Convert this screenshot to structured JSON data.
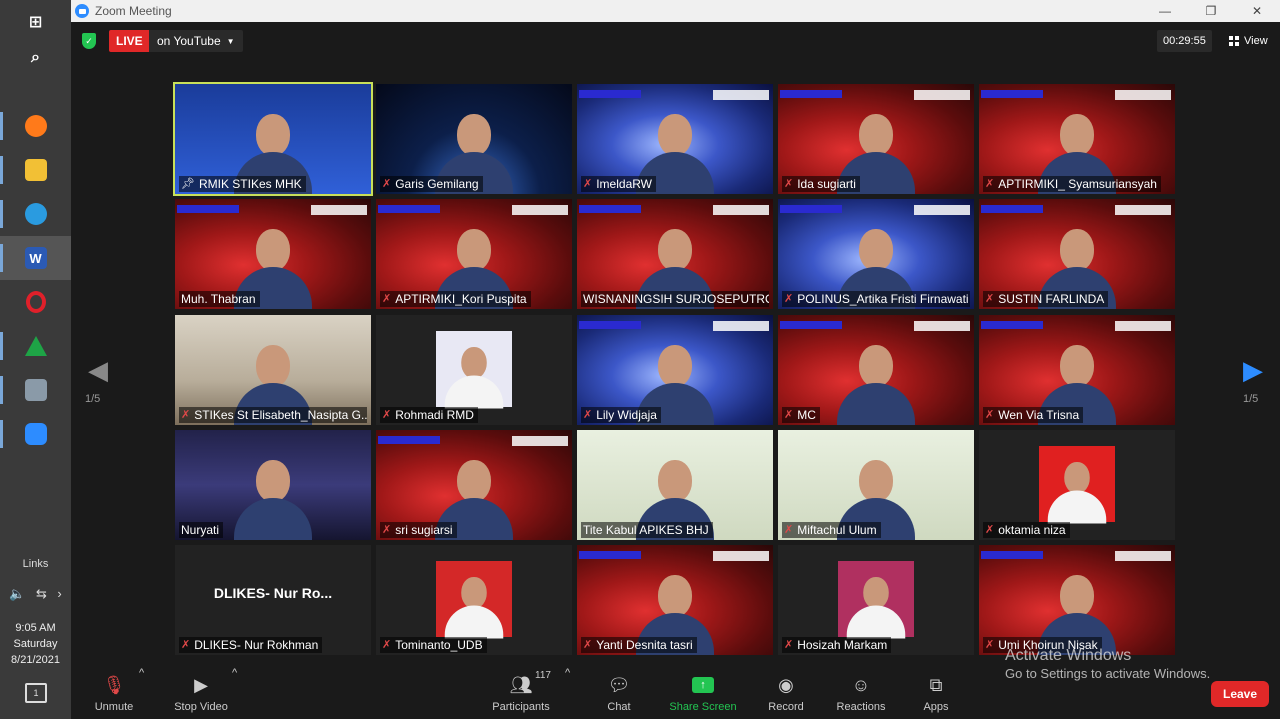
{
  "window": {
    "title": "Zoom Meeting",
    "minimize": "—",
    "maximize": "❐",
    "close": "✕"
  },
  "live": {
    "badge": "LIVE",
    "platform": "on YouTube"
  },
  "timer": "00:29:55",
  "view_label": "View",
  "pagination": {
    "prev_page": "1/5",
    "next_page": "1/5"
  },
  "participants": [
    {
      "name": "RMIK STIKes MHK",
      "pinned": true
    },
    {
      "name": "Garis Gemilang",
      "muted": true
    },
    {
      "name": "ImeldaRW",
      "muted": true
    },
    {
      "name": "Ida sugiarti",
      "muted": true
    },
    {
      "name": "APTIRMIKI_ Syamsuriansyah",
      "muted": true
    },
    {
      "name": "Muh. Thabran",
      "muted": false
    },
    {
      "name": "APTIRMIKI_Kori Puspita",
      "muted": true
    },
    {
      "name": "WISNANINGSIH SURJOSEPUTRO",
      "muted": false
    },
    {
      "name": "POLINUS_Artika Fristi Firnawati",
      "muted": true
    },
    {
      "name": "SUSTIN FARLINDA",
      "muted": true
    },
    {
      "name": "STIKes St Elisabeth_Nasipta G...",
      "muted": true
    },
    {
      "name": "Rohmadi RMD",
      "muted": true
    },
    {
      "name": "Lily Widjaja",
      "muted": true
    },
    {
      "name": "MC",
      "muted": true
    },
    {
      "name": "Wen Via Trisna",
      "muted": true
    },
    {
      "name": "Nuryati",
      "muted": false
    },
    {
      "name": "sri sugiarsi",
      "muted": true
    },
    {
      "name": "Tite Kabul APIKES BHJ",
      "muted": false
    },
    {
      "name": "Miftachul Ulum",
      "muted": true
    },
    {
      "name": "oktamia niza",
      "muted": true
    },
    {
      "name": "DLIKES- Nur Rokhman",
      "muted": true,
      "center_label": "DLIKES- Nur Ro..."
    },
    {
      "name": "Tominanto_UDB",
      "muted": true
    },
    {
      "name": "Yanti Desnita tasri",
      "muted": true
    },
    {
      "name": "Hosizah Markam",
      "muted": true
    },
    {
      "name": "Umi Khoirun Nisak",
      "muted": true
    }
  ],
  "toolbar": {
    "unmute": "Unmute",
    "stop_video": "Stop Video",
    "participants": "Participants",
    "participants_count": "117",
    "chat": "Chat",
    "share_screen": "Share Screen",
    "record": "Record",
    "reactions": "Reactions",
    "apps": "Apps",
    "leave": "Leave"
  },
  "activation": {
    "title": "Activate Windows",
    "subtitle": "Go to Settings to activate Windows."
  },
  "taskbar": {
    "links": "Links",
    "time": "9:05 AM",
    "day": "Saturday",
    "date": "8/21/2021",
    "notifications": "1"
  },
  "colors": {
    "accent": "#2d8cff",
    "live": "#e02828",
    "share": "#23c552",
    "active_speaker": "#c8e05a",
    "muted_mic": "#e04848"
  }
}
